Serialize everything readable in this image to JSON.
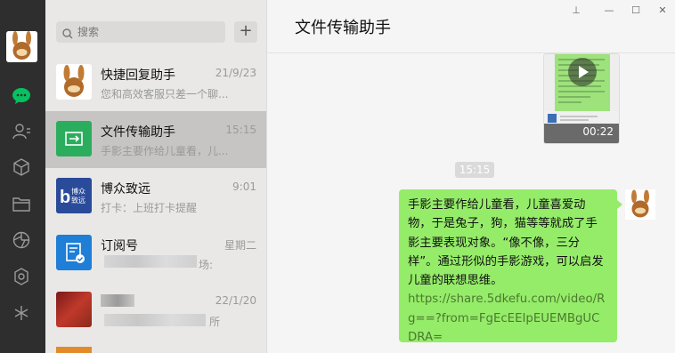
{
  "search": {
    "placeholder": "搜索"
  },
  "list_actions": {
    "add_label": "+"
  },
  "conversations": [
    {
      "name": "快捷回复助手",
      "time": "21/9/23",
      "preview": "您和高效客服只差一个聊..."
    },
    {
      "name": "文件传输助手",
      "time": "15:15",
      "preview": "手影主要作给儿童看，儿..."
    },
    {
      "name": "博众致远",
      "time": "9:01",
      "preview": "打卡：上班打卡提醒"
    },
    {
      "name": "订阅号",
      "time": "星期二",
      "preview": "场:"
    },
    {
      "name": "",
      "time": "22/1/20",
      "preview": "所"
    }
  ],
  "avatar_badges": {
    "bozhong": "博众\n致远"
  },
  "chat": {
    "title": "文件传输助手",
    "video_duration": "00:22",
    "timestamp": "15:15",
    "message_text": "手影主要作给儿童看，儿童喜爱动物，于是兔子，狗，猫等等就成了手影主要表现对象。“像不像，三分样”。通过形似的手影游戏，可以启发儿童的联想思维。",
    "message_link": "https://share.5dkefu.com/video/Rg==?from=FgEcEEIpEUEMBgUCDRA="
  },
  "window_controls": {
    "pin": "⊥",
    "min": "—",
    "max": "☐",
    "close": "✕"
  },
  "icons": {
    "rail": [
      "chat-icon",
      "contacts-icon",
      "collections-icon",
      "files-icon",
      "moments-icon",
      "mini-program-icon",
      "look-icon"
    ],
    "search": "search-icon"
  },
  "colors": {
    "rail_bg": "#2e2e2e",
    "accent_green": "#07c160",
    "bubble_green": "#95ec69",
    "list_bg": "#e9e8e7",
    "active_item": "#c6c5c4"
  }
}
